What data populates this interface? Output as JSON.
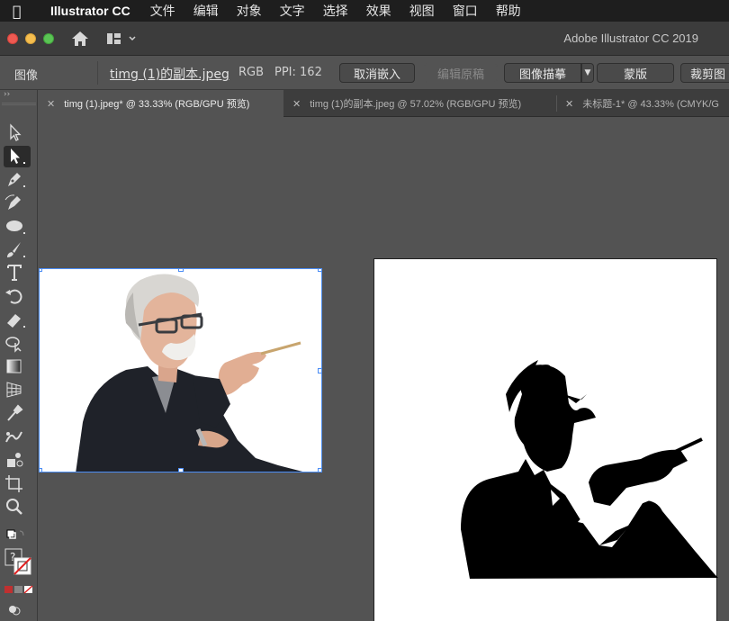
{
  "menubar": {
    "app_name": "Illustrator CC",
    "items": [
      "文件",
      "编辑",
      "对象",
      "文字",
      "选择",
      "效果",
      "视图",
      "窗口",
      "帮助"
    ]
  },
  "titlebar": {
    "app_title": "Adobe Illustrator CC 2019"
  },
  "controlbar": {
    "object_type": "图像",
    "file_name": "timg (1)的副本.jpeg",
    "color_mode": "RGB",
    "ppi": "PPI: 162",
    "unembed_label": "取消嵌入",
    "edit_original_label": "编辑原稿",
    "image_trace_label": "图像描摹",
    "mask_label": "蒙版",
    "crop_label": "裁剪图"
  },
  "tabs": [
    {
      "label": "timg (1).jpeg* @ 33.33% (RGB/GPU 预览)",
      "active": true
    },
    {
      "label": "timg (1)的副本.jpeg @ 57.02% (RGB/GPU 预览)",
      "active": false
    },
    {
      "label": "未标题-1* @ 43.33% (CMYK/G",
      "active": false
    }
  ],
  "tools": [
    "selection-tool",
    "direct-selection-tool",
    "pen-tool",
    "curvature-tool",
    "ellipse-tool",
    "paintbrush-tool",
    "type-tool",
    "rotate-tool",
    "eraser-tool",
    "shape-builder-tool",
    "gradient-tool",
    "perspective-grid-tool",
    "eyedropper-tool",
    "puppet-warp-tool",
    "symbol-sprayer-tool",
    "artboard-tool",
    "zoom-tool"
  ],
  "colors": {
    "accent_selection": "#4b8df5",
    "canvas_bg": "#535353",
    "menubar_bg": "#1e1e1e"
  }
}
